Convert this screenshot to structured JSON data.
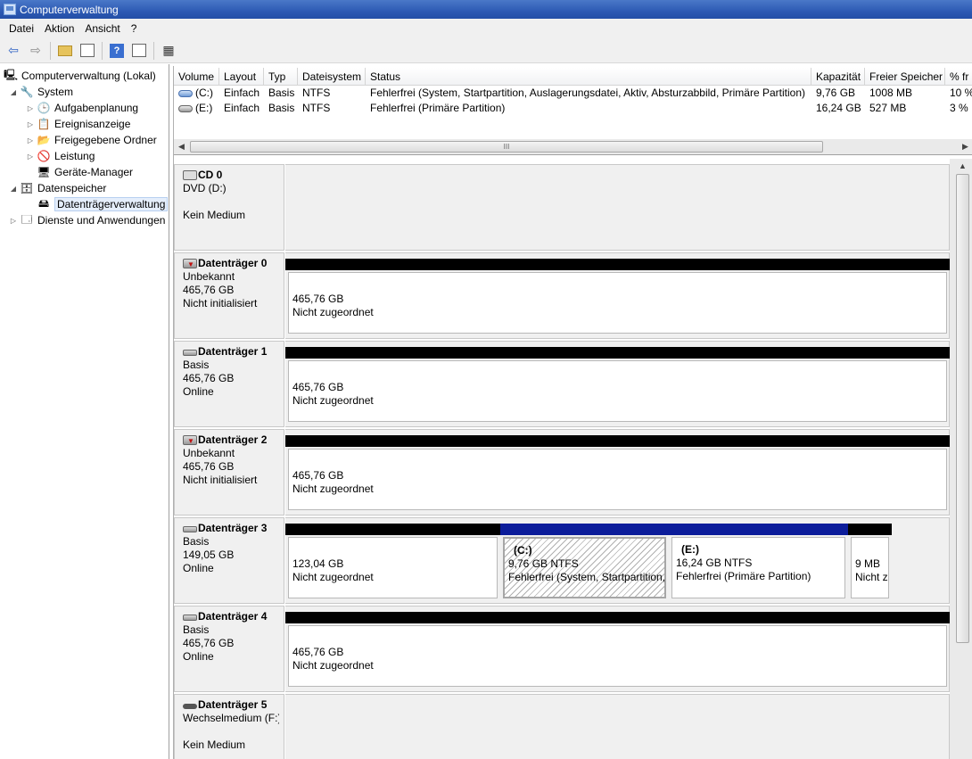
{
  "window": {
    "title": "Computerverwaltung"
  },
  "menu": [
    "Datei",
    "Aktion",
    "Ansicht",
    "?"
  ],
  "toolbar": {
    "icons": [
      "back-arrow-icon",
      "forward-arrow-icon",
      "up-folder-icon",
      "show-hide-tree-icon",
      "help-icon",
      "show-hide-action-pane-icon",
      "properties-icon"
    ]
  },
  "tree": {
    "root": "Computerverwaltung (Lokal)",
    "system": "System",
    "aufgabenplanung": "Aufgabenplanung",
    "ereignisanzeige": "Ereignisanzeige",
    "freigegebene_ordner": "Freigegebene Ordner",
    "leistung": "Leistung",
    "geraete_manager": "Geräte-Manager",
    "datenspeicher": "Datenspeicher",
    "datentraegerverwaltung": "Datenträgerverwaltung",
    "dienste": "Dienste und Anwendungen"
  },
  "volume_list": {
    "headers": [
      "Volume",
      "Layout",
      "Typ",
      "Dateisystem",
      "Status",
      "Kapazität",
      "Freier Speicher",
      "% fr"
    ],
    "rows": [
      {
        "volume": "(C:)",
        "layout": "Einfach",
        "typ": "Basis",
        "fs": "NTFS",
        "status": "Fehlerfrei (System, Startpartition, Auslagerungsdatei, Aktiv, Absturzabbild, Primäre Partition)",
        "kapazitaet": "9,76 GB",
        "frei": "1008 MB",
        "prozent": "10 %"
      },
      {
        "volume": "(E:)",
        "layout": "Einfach",
        "typ": "Basis",
        "fs": "NTFS",
        "status": "Fehlerfrei (Primäre Partition)",
        "kapazitaet": "16,24 GB",
        "frei": "527 MB",
        "prozent": "3 %"
      }
    ],
    "scroll_grip": "III"
  },
  "disks": [
    {
      "name": "CD 0",
      "line1": "DVD (D:)",
      "line2": "",
      "line3": "Kein Medium"
    },
    {
      "name": "Datenträger 0",
      "line1": "Unbekannt",
      "line2": "465,76 GB",
      "line3": "Nicht initialisiert",
      "part": {
        "size": "465,76 GB",
        "status": "Nicht zugeordnet"
      }
    },
    {
      "name": "Datenträger 1",
      "line1": "Basis",
      "line2": "465,76 GB",
      "line3": "Online",
      "part": {
        "size": "465,76 GB",
        "status": "Nicht zugeordnet"
      }
    },
    {
      "name": "Datenträger 2",
      "line1": "Unbekannt",
      "line2": "465,76 GB",
      "line3": "Nicht initialisiert",
      "part": {
        "size": "465,76 GB",
        "status": "Nicht zugeordnet"
      }
    },
    {
      "name": "Datenträger 3",
      "line1": "Basis",
      "line2": "149,05 GB",
      "line3": "Online",
      "parts": [
        {
          "size": "123,04 GB",
          "status": "Nicht zugeordnet"
        },
        {
          "label": "(C:)",
          "size": "9,76 GB NTFS",
          "status": "Fehlerfrei (System, Startpartition,"
        },
        {
          "label": "(E:)",
          "size": "16,24 GB NTFS",
          "status": "Fehlerfrei (Primäre Partition)"
        },
        {
          "size": "9 MB",
          "status": "Nicht z"
        }
      ]
    },
    {
      "name": "Datenträger 4",
      "line1": "Basis",
      "line2": "465,76 GB",
      "line3": "Online",
      "part": {
        "size": "465,76 GB",
        "status": "Nicht zugeordnet"
      }
    },
    {
      "name": "Datenträger 5",
      "line1": "Wechselmedium (F:)",
      "line2": "",
      "line3": "Kein Medium"
    }
  ]
}
